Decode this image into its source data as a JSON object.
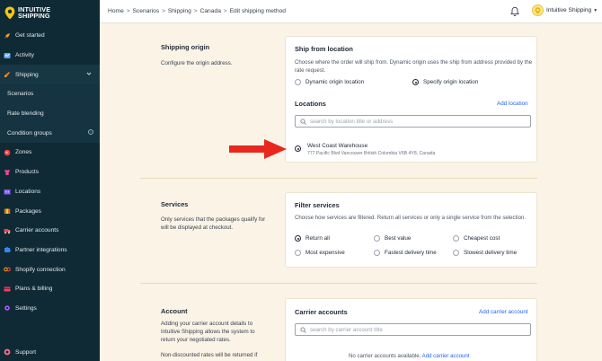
{
  "brand": {
    "line1": "INTUITIVE",
    "line2": "SHIPPING"
  },
  "sidebar": {
    "items": [
      {
        "label": "Get started"
      },
      {
        "label": "Activity"
      },
      {
        "label": "Shipping"
      },
      {
        "label": "Scenarios"
      },
      {
        "label": "Rate blending"
      },
      {
        "label": "Condition groups"
      },
      {
        "label": "Zones"
      },
      {
        "label": "Products"
      },
      {
        "label": "Locations"
      },
      {
        "label": "Packages"
      },
      {
        "label": "Carrier accounts"
      },
      {
        "label": "Partner integrations"
      },
      {
        "label": "Shopify connection"
      },
      {
        "label": "Plans & billing"
      },
      {
        "label": "Settings"
      }
    ],
    "support": "Support"
  },
  "topbar": {
    "breadcrumb": [
      "Home",
      "Scenarios",
      "Shipping",
      "Canada",
      "Edit shipping method"
    ],
    "account_name": "Intuitive Shipping"
  },
  "origin": {
    "title": "Shipping origin",
    "desc": "Configure the origin address.",
    "card_title": "Ship from location",
    "card_text": "Choose where the order will ship from. Dynamic origin uses the ship from address provided by the rate request.",
    "options": [
      "Dynamic origin location",
      "Specify origin location"
    ],
    "selected": "Specify origin location",
    "locations_title": "Locations",
    "add_location": "Add location",
    "search_placeholder": "search by location title or address",
    "location_name": "West Coast Warehouse",
    "location_address": "777 Pacific Blvd Vancouver British Columbia V6B 4Y8, Canada"
  },
  "services": {
    "title": "Services",
    "desc": "Only services that the packages qualify for will be displayed at checkout.",
    "card_title": "Filter services",
    "card_text": "Choose how services are filtered. Return all services or only a single service from the selection.",
    "options": [
      "Return all",
      "Best value",
      "Cheapest cost",
      "Most expensive",
      "Fastest delivery time",
      "Slowest delivery time"
    ],
    "selected": "Return all"
  },
  "account": {
    "title": "Account",
    "desc": "Adding your carrier account details to Intuitive Shipping allows the system to return your negotiated rates.",
    "desc2": "Non-discounted rates will be returned if",
    "card_title": "Carrier accounts",
    "add_carrier": "Add carrier account",
    "search_placeholder": "search by carrier account title",
    "empty_text": "No carrier accounts available.",
    "empty_link": "Add carrier account"
  },
  "colors": {
    "sidebar": "#0f2a35",
    "background": "#fbf4e6",
    "link": "#2563eb",
    "arrow": "#e8271f"
  }
}
